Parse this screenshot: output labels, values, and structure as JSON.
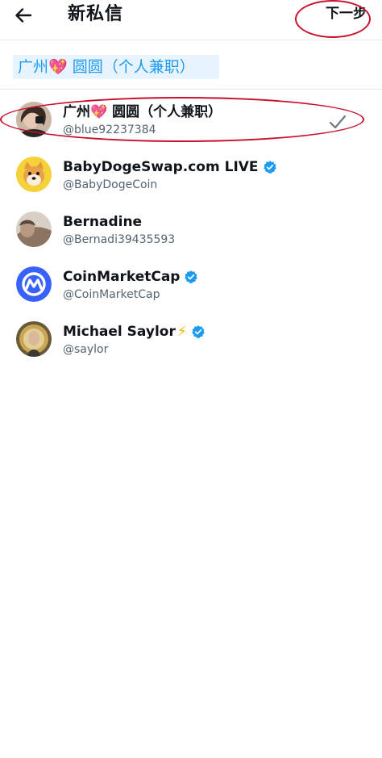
{
  "header": {
    "title": "新私信",
    "next_label": "下一步",
    "back_icon": "arrow-left-icon"
  },
  "selected_chip": {
    "label": "广州💖 圆圆（个人兼职）"
  },
  "users": [
    {
      "name": "广州💖 圆圆（个人兼职）",
      "handle": "@blue92237384",
      "verified": false,
      "selected": true
    },
    {
      "name": "BabyDogeSwap.com LIVE",
      "handle": "@BabyDogeCoin",
      "verified": true,
      "selected": false
    },
    {
      "name": "Bernadine",
      "handle": "@Bernadi39435593",
      "verified": false,
      "selected": false
    },
    {
      "name": "CoinMarketCap",
      "handle": "@CoinMarketCap",
      "verified": true,
      "selected": false
    },
    {
      "name": "Michael Saylor",
      "name_suffix": "⚡",
      "handle": "@saylor",
      "verified": true,
      "selected": false
    }
  ],
  "colors": {
    "accent": "#1d9bf0",
    "annotation": "#c8102e",
    "check": "#6e767d"
  }
}
